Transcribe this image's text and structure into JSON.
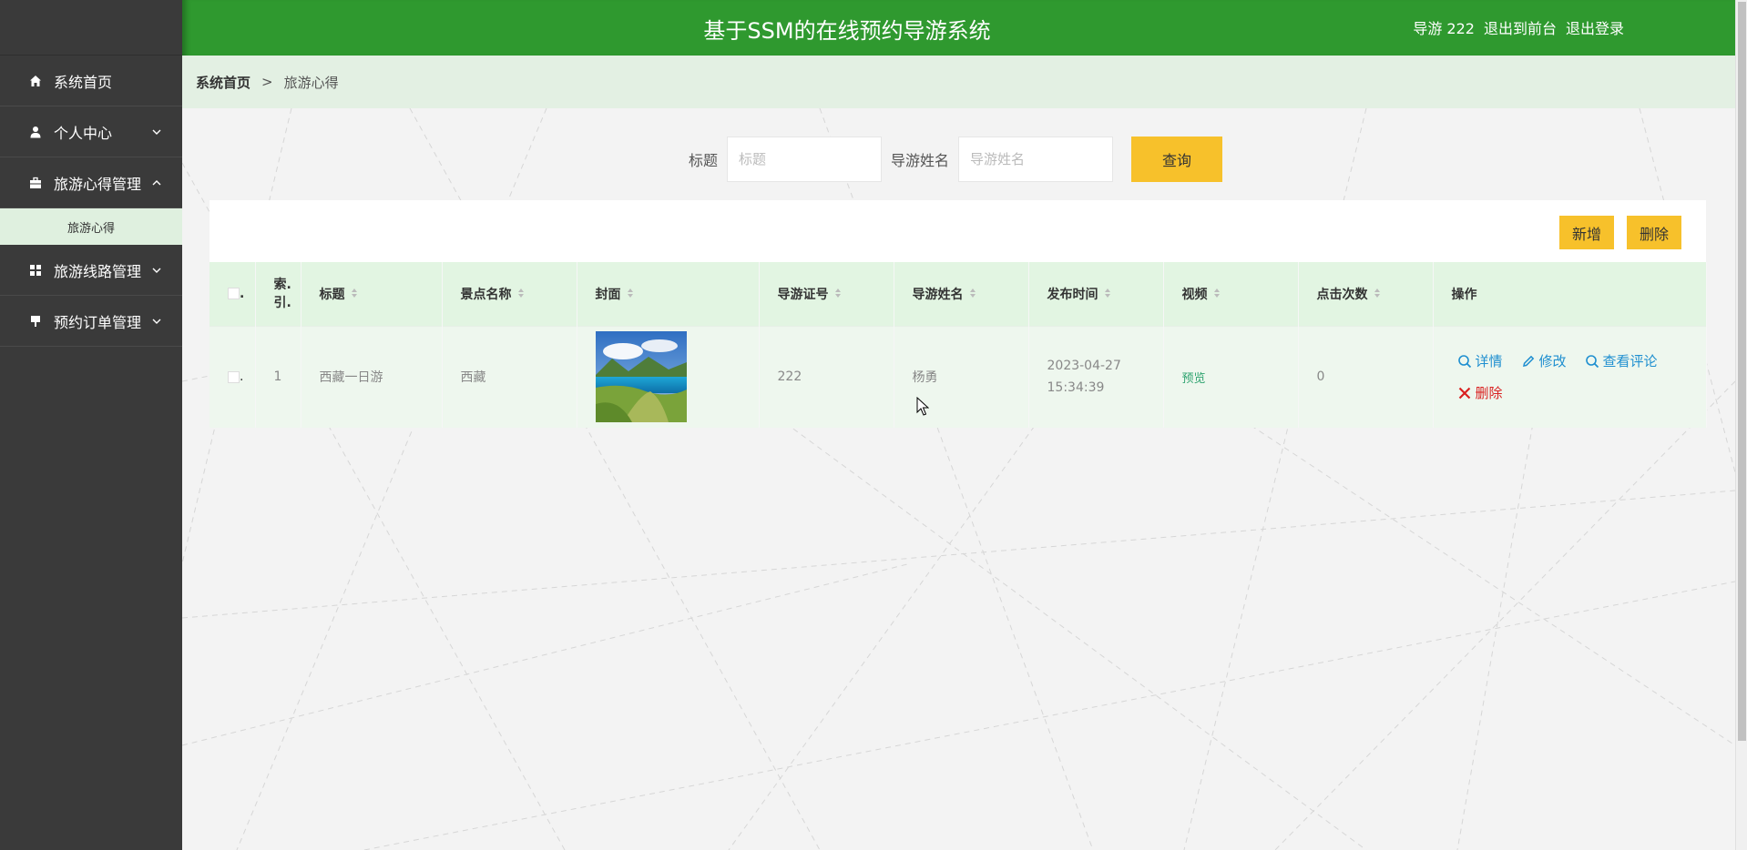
{
  "header": {
    "title": "基于SSM的在线预约导游系统",
    "user": "导游 222",
    "to_front": "退出到前台",
    "logout": "退出登录"
  },
  "sidebar": {
    "items": [
      {
        "label": "系统首页",
        "icon": "home-icon"
      },
      {
        "label": "个人中心",
        "icon": "user-icon"
      },
      {
        "label": "旅游心得管理",
        "icon": "briefcase-icon",
        "submenu": [
          "旅游心得"
        ]
      },
      {
        "label": "旅游线路管理",
        "icon": "grid-icon"
      },
      {
        "label": "预约订单管理",
        "icon": "clipboard-icon"
      }
    ]
  },
  "breadcrumb": {
    "home": "系统首页",
    "sep": ">",
    "current": "旅游心得"
  },
  "search": {
    "title_label": "标题",
    "title_placeholder": "标题",
    "guide_label": "导游姓名",
    "guide_placeholder": "导游姓名",
    "query_button": "查询"
  },
  "toolbar": {
    "add": "新增",
    "delete": "删除"
  },
  "table": {
    "headers": [
      "索引",
      "标题",
      "景点名称",
      "封面",
      "导游证号",
      "导游姓名",
      "发布时间",
      "视频",
      "点击次数",
      "操作"
    ],
    "index_header_lines": [
      "索.",
      "引."
    ],
    "rows": [
      {
        "index": "1",
        "title": "西藏一日游",
        "scenic": "西藏",
        "guide_no": "222",
        "guide_name": "杨勇",
        "publish_time": "2023-04-27 15:34:39",
        "video": "预览",
        "clicks": "0",
        "ops": {
          "detail": "详情",
          "edit": "修改",
          "comments": "查看评论",
          "delete": "删除"
        }
      }
    ]
  },
  "colors": {
    "header": "#2f992f",
    "accent_yellow": "#f7c12b",
    "sidebar": "#3a3a3a"
  }
}
